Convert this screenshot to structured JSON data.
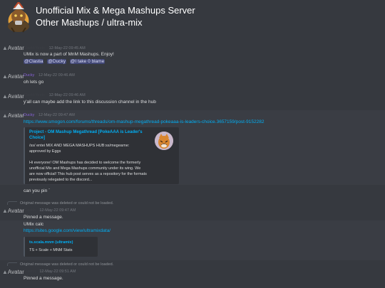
{
  "header": {
    "server_name": "Unofficial Mix & Mega Mashups Server",
    "channel_path": "Other Mashups / ultra-mix"
  },
  "avatar_alt": "Avatar",
  "messages": [
    {
      "user": "ClasticYeets",
      "timestamp": "12-May-22 09:45 AM",
      "text": "UMix is now a part of MnM Mashups. Enjoy!",
      "mentions": [
        "@Clastia",
        "@Ducky",
        "@I take 0 blame"
      ]
    },
    {
      "user": "Ducky",
      "timestamp": "12-May-22 09:46 AM",
      "text": "oh lets go"
    },
    {
      "user": "ClasticYeets",
      "timestamp": "12-May-22 09:46 AM",
      "text": "y'all can maybe add the link to this discussion channel in the hub"
    },
    {
      "user": "Ducky",
      "timestamp": "12-May-22 09:47 AM",
      "link": "https://www.smogon.com/forums/threads/om-mashup-megathread-pokeaaa-is-leaders-choice.3657159/post-9152282",
      "embed": {
        "title_line1": "Project - OM Mashup Megathread [PokeAAA is Leader's",
        "title_line2": "Choice]",
        "lines": [
          "/ss/ entei MIX AND MEGA MASHUPS HUB:ss/megearne:",
          "approved by Eggs",
          "",
          "Hi everyone! OM Mashups has decided to welcome the formerly",
          "unofficial Mix and Mega Mashups community under its wing. We",
          "are now official! This hub post serves as a repository for the formats",
          "previously relegated to the discord..."
        ]
      },
      "after_text": "can you pin `"
    },
    {
      "reply": "Original message was deleted or could not be loaded.",
      "user": "Clastia",
      "timestamp": "12-May-22 09:47 AM",
      "text": "Pinned a message.",
      "extra_text": "UMix calc",
      "link": "https://sites.google.com/view/ultramixdata/",
      "embed": {
        "title": "ts.scala.mnm (ultramix)",
        "text": "TS + Scale + MNM Stats"
      }
    },
    {
      "reply": "Original message was deleted or could not be loaded.",
      "user": "Clastia",
      "timestamp": "12-May-22 09:51 AM",
      "text": "Pinned a message."
    }
  ]
}
